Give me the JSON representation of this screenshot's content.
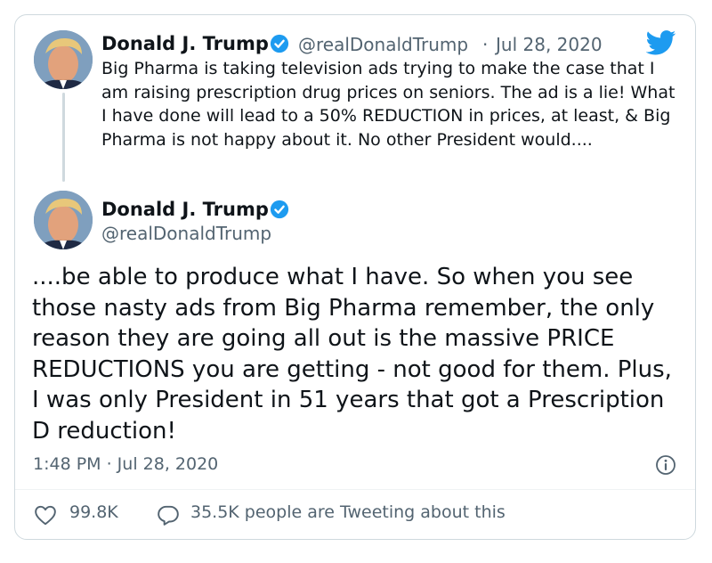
{
  "reply_tweet": {
    "author_name": "Donald J. Trump",
    "handle": "@realDonaldTrump",
    "separator": "·",
    "date": "Jul 28, 2020",
    "text": "Big Pharma is taking television ads trying to make the case that I am raising prescription drug prices on seniors. The ad is a lie! What I have done will lead to a 50% REDUCTION in prices, at least, & Big Pharma is not happy about it. No other President would...."
  },
  "main_tweet": {
    "author_name": "Donald J. Trump",
    "handle": "@realDonaldTrump",
    "text": "....be able to produce what I have. So when you see those nasty ads from Big Pharma remember, the only reason they are going all out is the massive PRICE REDUCTIONS you are getting - not good for them. Plus, I was only President in 51 years that got a Prescription D reduction!",
    "timestamp": "1:48 PM · Jul 28, 2020",
    "likes": "99.8K",
    "tweeting_about": "35.5K people are Tweeting about this"
  },
  "icons": {
    "brand": "twitter-bird-icon",
    "verified": "verified-badge-icon",
    "info": "info-icon",
    "like": "heart-icon",
    "reply": "speech-bubble-icon"
  },
  "colors": {
    "brand_blue": "#1d9bf0",
    "text_primary": "#0f1419",
    "text_secondary": "#536471",
    "border": "#cfd9de"
  }
}
